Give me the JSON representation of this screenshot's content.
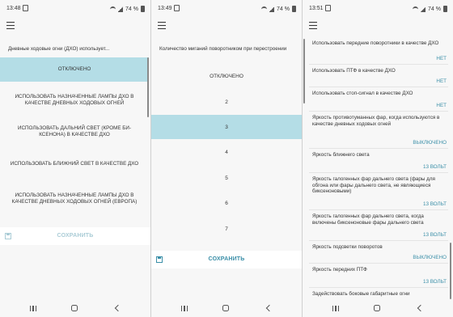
{
  "colors": {
    "accent": "#3b8fa8",
    "selected_bg": "#b4dde6",
    "save_disabled": "#aaccd6",
    "save_enabled": "#3b8fa8"
  },
  "panel1": {
    "status": {
      "time": "13:48",
      "battery": "74 %"
    },
    "title": "Дневные ходовые огни (ДХО) использует...",
    "options": [
      {
        "label": "ОТКЛЮЧЕНО",
        "selected": true
      },
      {
        "label": "ИСПОЛЬЗОВАТЬ НАЗНАЧЕННЫЕ ЛАМПЫ ДХО В КАЧЕСТВЕ ДНЕВНЫХ ХОДОВЫХ ОГНЕЙ",
        "selected": false
      },
      {
        "label": "ИСПОЛЬЗОВАТЬ ДАЛЬНИЙ СВЕТ (КРОМЕ БИ-КСЕНОНА) В КАЧЕСТВЕ ДХО",
        "selected": false
      },
      {
        "label": "ИСПОЛЬЗОВАТЬ БЛИЖНИЙ СВЕТ В КАЧЕСТВЕ ДХО",
        "selected": false
      },
      {
        "label": "ИСПОЛЬЗОВАТЬ НАЗНАЧЕННЫЕ ЛАМПЫ ДХО В КАЧЕСТВЕ ДНЕВНЫХ ХОДОВЫХ ОГНЕЙ (ЕВРОПА)",
        "selected": false
      }
    ],
    "save_label": "СОХРАНИТЬ",
    "save_enabled": false
  },
  "panel2": {
    "status": {
      "time": "13:49",
      "battery": "74 %"
    },
    "title": "Количество миганий поворотником при перестроении",
    "options": [
      {
        "label": "ОТКЛЮЧЕНО",
        "selected": false
      },
      {
        "label": "2",
        "selected": false
      },
      {
        "label": "3",
        "selected": true
      },
      {
        "label": "4",
        "selected": false
      },
      {
        "label": "5",
        "selected": false
      },
      {
        "label": "6",
        "selected": false
      },
      {
        "label": "7",
        "selected": false
      }
    ],
    "save_label": "СОХРАНИТЬ",
    "save_enabled": true
  },
  "panel3": {
    "status": {
      "time": "13:51",
      "battery": "74 %"
    },
    "settings": [
      {
        "label": "Использовать передние поворотники в качестве ДХО",
        "value": "НЕТ"
      },
      {
        "label": "Использовать ПТФ в качестве ДХО",
        "value": "НЕТ"
      },
      {
        "label": "Использовать стоп-сигнал в качестве ДХО",
        "value": "НЕТ"
      },
      {
        "label": "Яркость противотуманных фар, когда используются в качестве дневных ходовых огней",
        "value": "ВЫКЛЮЧЕНО"
      },
      {
        "label": "Яркость ближнего света",
        "value": "13 ВОЛЬТ"
      },
      {
        "label": "Яркость галогенных фар дальнего света (фары для обгона или фары дальнего света, не являющиеся биксеноновыми)",
        "value": "13 ВОЛЬТ"
      },
      {
        "label": "Яркость галогенных фар дальнего света, когда включены биксеноновые фары дальнего света",
        "value": "13 ВОЛЬТ"
      },
      {
        "label": "Яркость подсветки поворотов",
        "value": "ВЫКЛЮЧЕНО"
      },
      {
        "label": "Яркость передних ПТФ",
        "value": "13 ВОЛЬТ"
      },
      {
        "label": "Задействовать боковые габаритные огни",
        "value": ""
      }
    ]
  }
}
